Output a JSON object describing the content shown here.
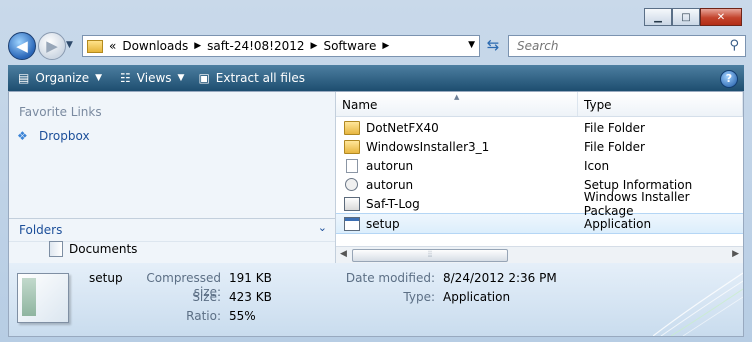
{
  "window": {
    "caption": {
      "minimize": "▁",
      "maximize": "□",
      "close": "✕"
    }
  },
  "nav": {
    "back_icon": "back-arrow",
    "forward_icon": "forward-arrow",
    "address": {
      "overflow": "«",
      "crumbs": [
        "Downloads",
        "saft-24!08!2012",
        "Software"
      ]
    },
    "search_placeholder": "Search"
  },
  "toolbar": {
    "organize": "Organize",
    "views": "Views",
    "extract": "Extract all files",
    "help": "?"
  },
  "left_pane": {
    "favorites_heading": "Favorite Links",
    "favorites": [
      "Dropbox"
    ],
    "folders_heading": "Folders",
    "tree": [
      "Documents"
    ]
  },
  "file_list": {
    "columns": [
      "Name",
      "Type"
    ],
    "rows": [
      {
        "name": "DotNetFX40",
        "type": "File Folder",
        "icon": "folder"
      },
      {
        "name": "WindowsInstaller3_1",
        "type": "File Folder",
        "icon": "folder"
      },
      {
        "name": "autorun",
        "type": "Icon",
        "icon": "doc"
      },
      {
        "name": "autorun",
        "type": "Setup Information",
        "icon": "setupinf"
      },
      {
        "name": "Saf-T-Log",
        "type": "Windows Installer Package",
        "icon": "msi"
      },
      {
        "name": "setup",
        "type": "Application",
        "icon": "app",
        "selected": true
      }
    ]
  },
  "details": {
    "name": "setup",
    "compressed_size_label": "Compressed size:",
    "compressed_size": "191 KB",
    "size_label": "Size:",
    "size": "423 KB",
    "ratio_label": "Ratio:",
    "ratio": "55%",
    "date_modified_label": "Date modified:",
    "date_modified": "8/24/2012 2:36 PM",
    "type_label": "Type:",
    "type": "Application"
  },
  "colors": {
    "toolbar": "#1d4d6f",
    "link": "#1c4f9a",
    "selection": "#dceefc"
  }
}
